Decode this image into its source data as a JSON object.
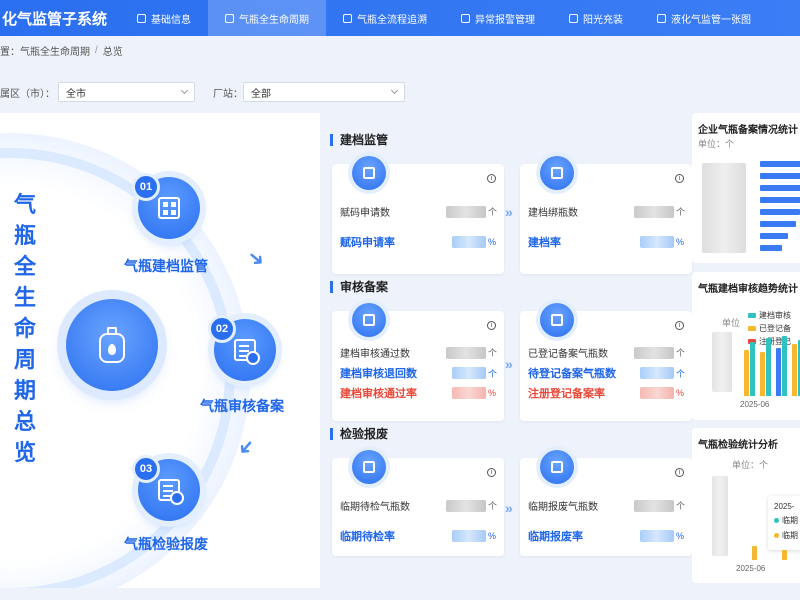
{
  "app": {
    "title": "化气监管子系统"
  },
  "nav": [
    {
      "label": "基础信息",
      "active": false
    },
    {
      "label": "气瓶全生命周期",
      "active": true
    },
    {
      "label": "气瓶全流程追溯",
      "active": false
    },
    {
      "label": "异常报警管理",
      "active": false
    },
    {
      "label": "阳光充装",
      "active": false
    },
    {
      "label": "液化气监管一张图",
      "active": false
    }
  ],
  "breadcrumb": {
    "prefix": "置：",
    "parent": "气瓶全生命周期",
    "sep": "/",
    "current": "总览"
  },
  "filters": {
    "region_label": "属区（市）：",
    "region_value": "全市",
    "station_label": "厂站：",
    "station_value": "全部"
  },
  "hero": {
    "title_chars": [
      "气",
      "瓶",
      "全",
      "生",
      "命",
      "周",
      "期",
      "总",
      "览"
    ],
    "steps": [
      {
        "num": "01",
        "label": "气瓶建档监管",
        "icon": "archive-grid-icon"
      },
      {
        "num": "02",
        "label": "气瓶审核备案",
        "icon": "document-review-icon"
      },
      {
        "num": "03",
        "label": "气瓶检验报废",
        "icon": "document-scrap-icon"
      }
    ],
    "center_icon": "gas-cylinder-icon"
  },
  "sections": [
    {
      "title": "建档监管",
      "cards": [
        {
          "icon": "code-apply-icon",
          "rows": [
            {
              "label": "赋码申请数",
              "unit": "个",
              "style": "normal"
            },
            {
              "label": "赋码申请率",
              "unit": "%",
              "style": "blue"
            }
          ]
        },
        {
          "icon": "binding-icon",
          "rows": [
            {
              "label": "建档绑瓶数",
              "unit": "个",
              "style": "normal"
            },
            {
              "label": "建档率",
              "unit": "%",
              "style": "blue"
            }
          ]
        }
      ]
    },
    {
      "title": "审核备案",
      "cards": [
        {
          "icon": "pie-check-icon",
          "rows": [
            {
              "label": "建档审核通过数",
              "unit": "个",
              "style": "normal"
            },
            {
              "label": "建档审核退回数",
              "unit": "个",
              "style": "blue"
            },
            {
              "label": "建档审核通过率",
              "unit": "%",
              "style": "red"
            }
          ]
        },
        {
          "icon": "calendar-register-icon",
          "rows": [
            {
              "label": "已登记备案气瓶数",
              "unit": "个",
              "style": "normal"
            },
            {
              "label": "待登记备案气瓶数",
              "unit": "个",
              "style": "blue"
            },
            {
              "label": "注册登记备案率",
              "unit": "%",
              "style": "red"
            }
          ]
        }
      ]
    },
    {
      "title": "检验报废",
      "cards": [
        {
          "icon": "inspect-icon",
          "rows": [
            {
              "label": "临期待检气瓶数",
              "unit": "个",
              "style": "normal"
            },
            {
              "label": "临期待检率",
              "unit": "%",
              "style": "blue"
            }
          ]
        },
        {
          "icon": "trash-icon",
          "rows": [
            {
              "label": "临期报废气瓶数",
              "unit": "个",
              "style": "normal"
            },
            {
              "label": "临期报废率",
              "unit": "%",
              "style": "blue"
            }
          ]
        }
      ]
    }
  ],
  "panels": [
    {
      "title": "企业气瓶备案情况统计",
      "unit": "单位：个"
    },
    {
      "title": "气瓶建档审核趋势统计",
      "unit": "单位",
      "legend": [
        "建档审核",
        "已登记备",
        "注册登记"
      ],
      "x_tick": "2025-06"
    },
    {
      "title": "气瓶检验统计分析",
      "unit": "单位：个",
      "legend": [
        "2025-",
        "临期",
        "临期"
      ],
      "x_tick": "2025-06"
    }
  ],
  "colors": {
    "primary": "#2a6ff0",
    "accent_red": "#e8493a",
    "teal": "#2fc2c0",
    "yellow": "#f5b82e"
  }
}
